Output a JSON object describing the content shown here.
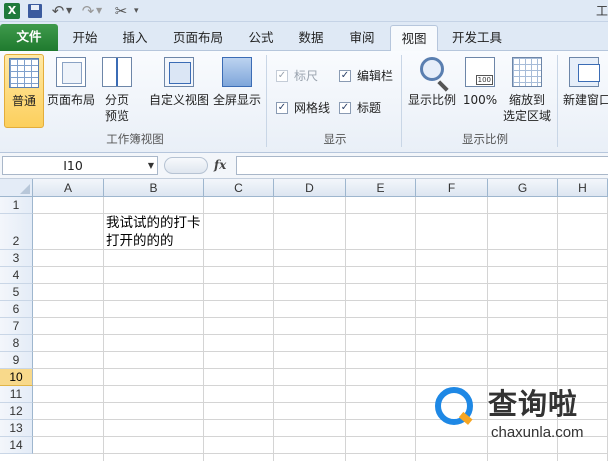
{
  "qat": {
    "app_icon": "X",
    "title_partial": "工"
  },
  "tabs": [
    {
      "label": "文件"
    },
    {
      "label": "开始"
    },
    {
      "label": "插入"
    },
    {
      "label": "页面布局"
    },
    {
      "label": "公式"
    },
    {
      "label": "数据"
    },
    {
      "label": "审阅"
    },
    {
      "label": "视图"
    },
    {
      "label": "开发工具"
    }
  ],
  "ribbon": {
    "workbook_views": {
      "label": "工作簿视图",
      "normal": "普通",
      "page_layout": "页面布局",
      "page_break_line1": "分页",
      "page_break_line2": "预览",
      "custom_views": "自定义视图",
      "full_screen": "全屏显示"
    },
    "show": {
      "label": "显示",
      "ruler": "标尺",
      "formula_bar": "编辑栏",
      "gridlines": "网格线",
      "headings": "标题"
    },
    "zoom": {
      "label": "显示比例",
      "zoom": "显示比例",
      "zoom_100": "100%",
      "zoom_selection_line1": "缩放到",
      "zoom_selection_line2": "选定区域"
    },
    "window": {
      "new_window": "新建窗口"
    }
  },
  "formula_bar": {
    "name_box": "I10",
    "fx": "fx",
    "value": ""
  },
  "sheet": {
    "columns": [
      "A",
      "B",
      "C",
      "D",
      "E",
      "F",
      "G",
      "H"
    ],
    "rows": [
      "1",
      "2",
      "3",
      "4",
      "5",
      "6",
      "7",
      "8",
      "9",
      "10",
      "11",
      "12",
      "13",
      "14"
    ],
    "active_row": "10",
    "cell_b2": "我试试的的打卡打开的的的"
  },
  "watermark": {
    "text": "查询啦",
    "url": "chaxunla.com"
  }
}
